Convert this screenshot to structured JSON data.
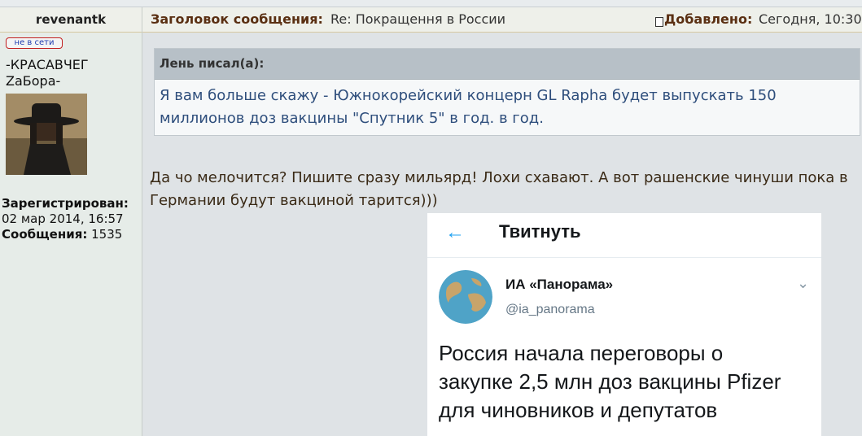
{
  "sidebar": {
    "username": "revenantk",
    "status": "не в сети",
    "title_line1": "-КРАСАВЧЕГ",
    "title_line2": "ZaБора-",
    "registered_label": "Зарегистрирован:",
    "registered_date": "02 мар 2014, 16:57",
    "posts_label": "Сообщения:",
    "posts_count": "1535"
  },
  "header": {
    "subject_label": "Заголовок сообщения:",
    "subject": "Re: Покращення в России",
    "added_label": "Добавлено:",
    "added_value": "Сегодня, 10:30"
  },
  "quote": {
    "author": "Лень писал(а):",
    "line1": "Я вам больше скажу - Южнокорейский концерн GL Rapha будет выпускать 150",
    "line2": "миллионов доз вакцины \"Спутник 5\" в год. в год."
  },
  "post": {
    "line1": "Да чо мелочится? Пишите сразу мильярд! Лохи схавают. А вот рашенские чинуши пока в",
    "line2": "Германии будут вакциной тарится)))"
  },
  "tweet": {
    "back_icon": "←",
    "title": "Твитнуть",
    "account_name": "ИА «Панорама»",
    "handle": "@ia_panorama",
    "chevron_icon": "⌄",
    "text_line1": "Россия начала переговоры о",
    "text_line2": "закупке 2,5 млн доз вакцины Pfizer",
    "text_line3": "для чиновников и депутатов"
  }
}
